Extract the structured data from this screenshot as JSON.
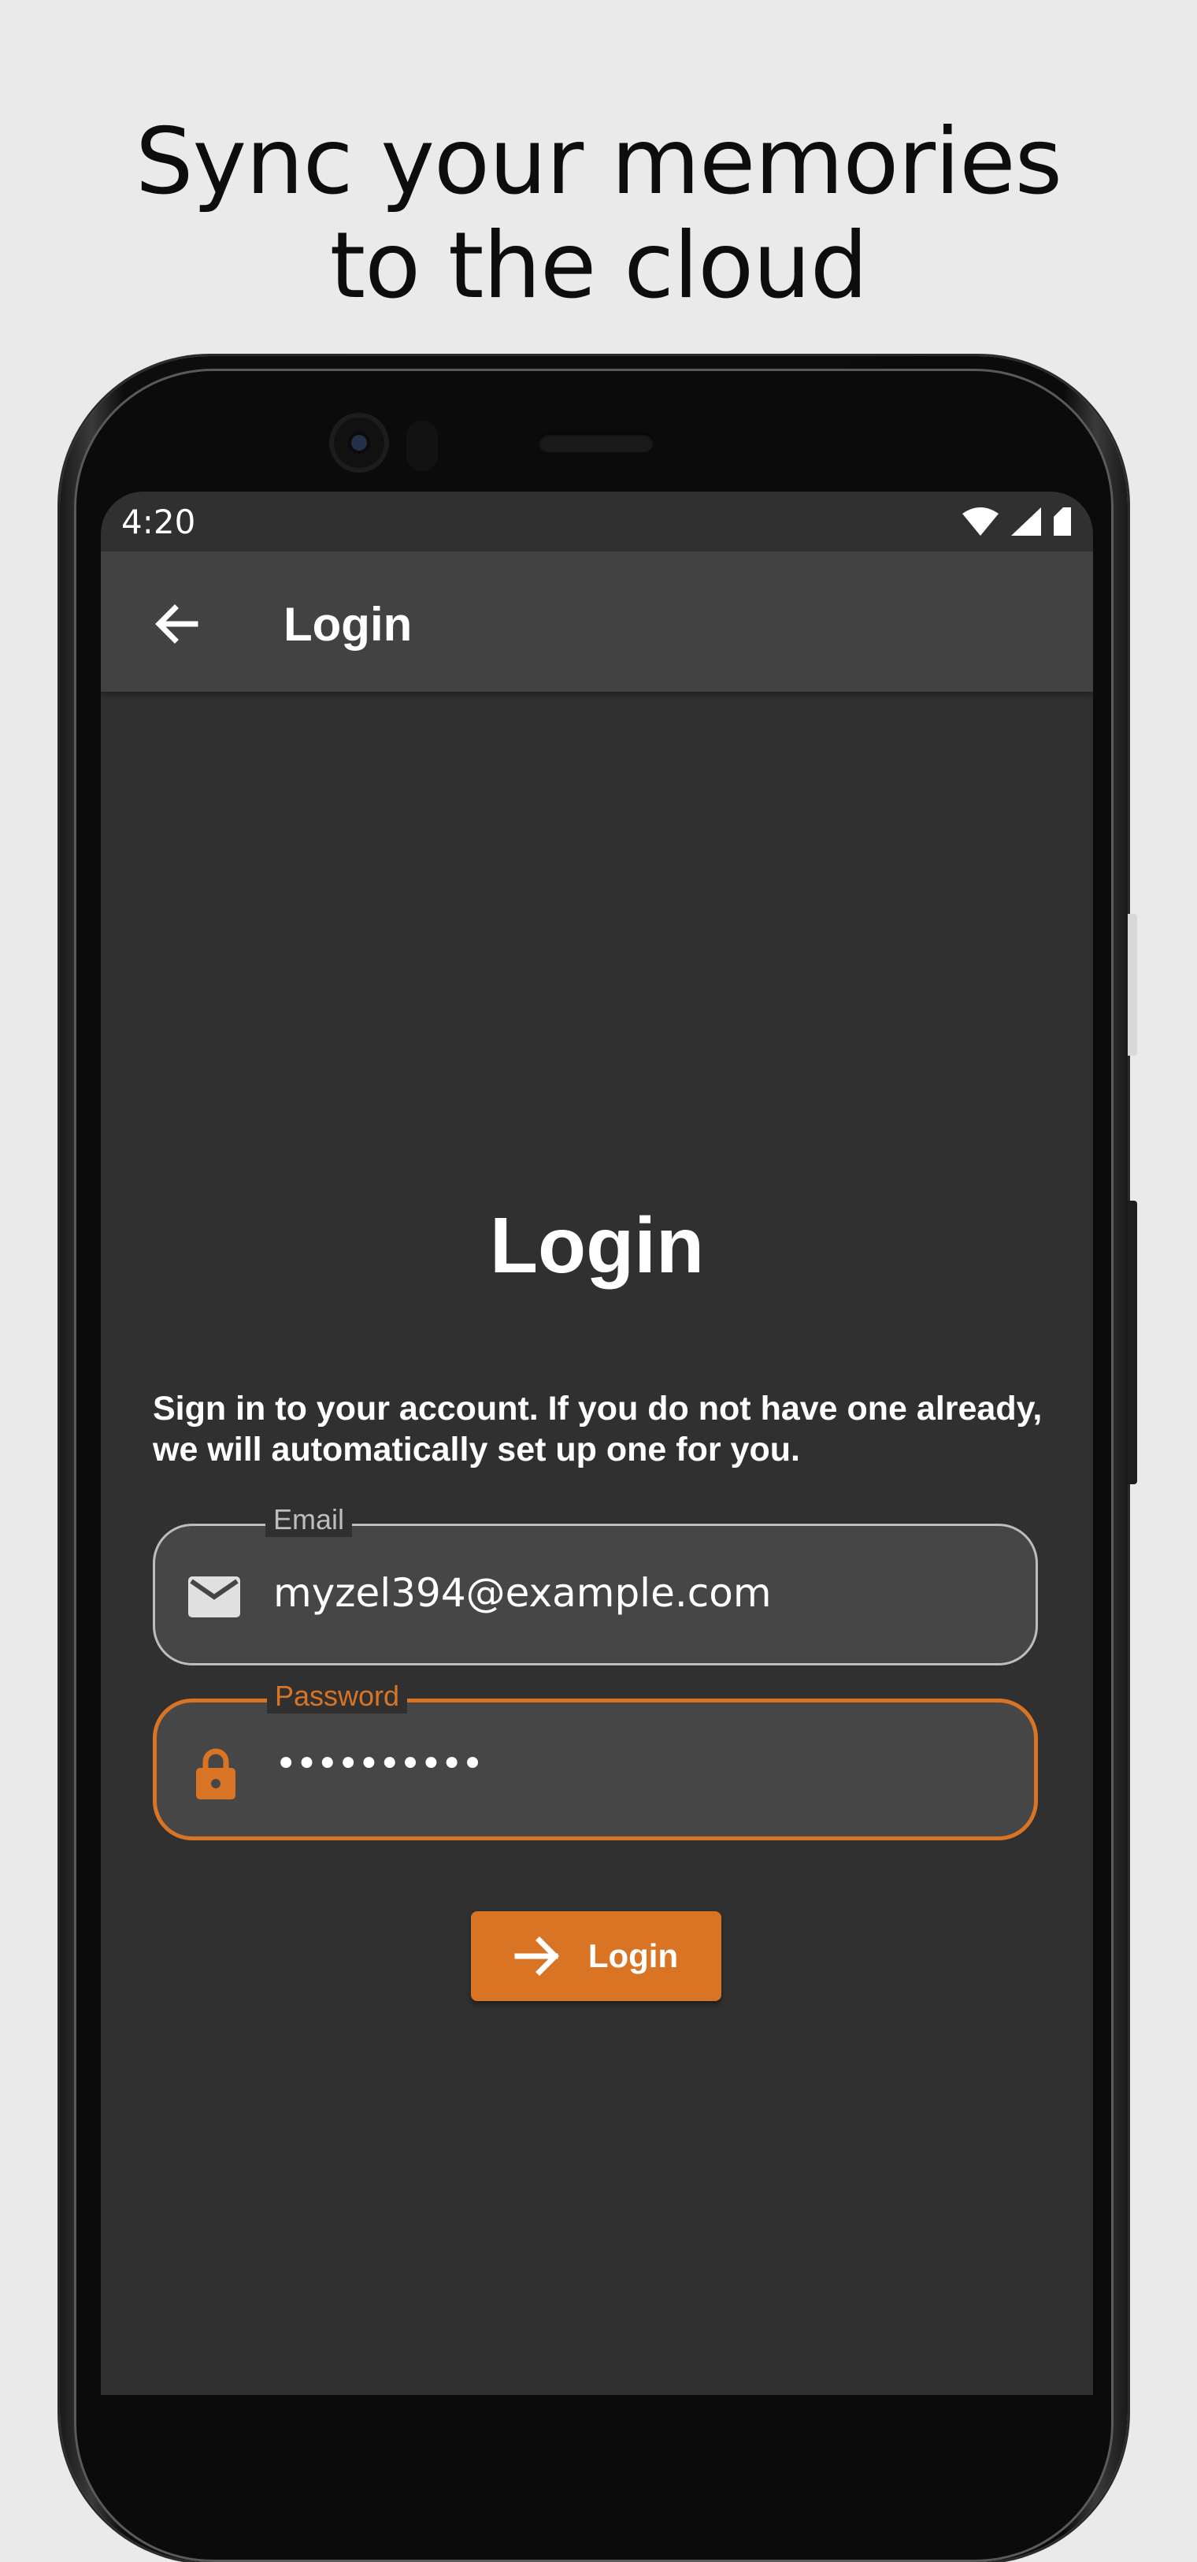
{
  "promo": {
    "headline_line1": "Sync your memories",
    "headline_line2": "to the cloud"
  },
  "status_bar": {
    "time": "4:20",
    "icons": [
      "wifi-icon",
      "signal-icon",
      "battery-icon"
    ]
  },
  "app_bar": {
    "back_icon": "arrow-left-icon",
    "title": "Login"
  },
  "login": {
    "heading": "Login",
    "intro": "Sign in to your account. If you do not have one already, we will automatically set up one for you.",
    "email": {
      "label": "Email",
      "value": "myzel394@example.com",
      "icon": "mail-icon"
    },
    "password": {
      "label": "Password",
      "value": "••••••••••",
      "icon": "lock-icon"
    },
    "submit": {
      "label": "Login",
      "icon": "arrow-right-icon"
    }
  },
  "colors": {
    "accent": "#d97424",
    "background": "#303030",
    "app_bar": "#424242",
    "field_fill": "#464646"
  }
}
